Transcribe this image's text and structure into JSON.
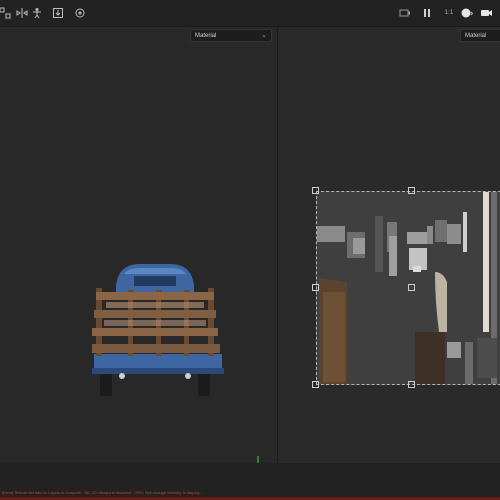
{
  "toolbar": {
    "left_icons": [
      "grid-snap-icon",
      "symmetry-icon",
      "mannequin-icon",
      "export-icon",
      "settings-icon"
    ],
    "right_icons": [
      "camera-icon",
      "pause-icon",
      "wireframe-icon",
      "render-mode-icon",
      "record-icon"
    ],
    "ratio_label": "1:1"
  },
  "left_viewport": {
    "channel_dropdown": "Material"
  },
  "right_viewport": {
    "channel_dropdown": "Material"
  },
  "status_bar": {
    "message": "[Error] Texture set has no Layers to compute - 3D, 2D viewports disabled - GPU: Not enough memory to display..."
  },
  "colors": {
    "background": "#272727",
    "truck_cab": "#3e66a3",
    "truck_wood": "#7a5a40",
    "axis_green": "#2fbf3b",
    "error_red": "#c2403a"
  }
}
